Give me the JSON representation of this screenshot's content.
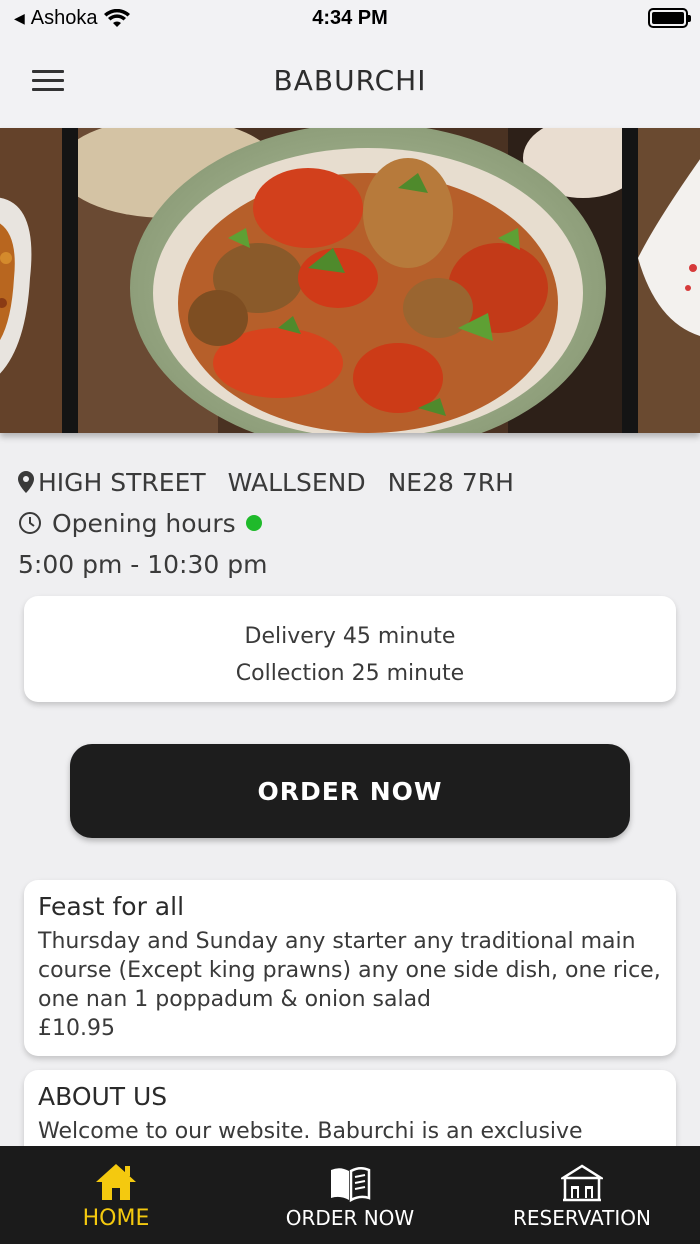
{
  "status_bar": {
    "carrier": "Ashoka",
    "time": "4:34 PM"
  },
  "nav": {
    "title": "BABURCHI"
  },
  "restaurant": {
    "address_parts": [
      "HIGH STREET",
      "WALLSEND",
      "NE28 7RH"
    ],
    "opening_label": "Opening hours",
    "hours": "5:00 pm - 10:30 pm",
    "open_status_color": "#1fba2b"
  },
  "delivery": {
    "delivery_text": "Delivery 45 minute",
    "collection_text": "Collection 25 minute"
  },
  "order_button": {
    "label": "ORDER NOW"
  },
  "cards": {
    "feast": {
      "title": "Feast for all",
      "body": "Thursday and Sunday any starter any traditional main course (Except king prawns) any one side dish, one rice, one nan 1 poppadum & onion salad",
      "price": "£10.95"
    },
    "about": {
      "title": "ABOUT US",
      "body": "Welcome to our website. Baburchi is an exclusive"
    }
  },
  "tabs": [
    {
      "label": "HOME",
      "icon": "house-icon",
      "active": true
    },
    {
      "label": "ORDER NOW",
      "icon": "open-book-icon",
      "active": false
    },
    {
      "label": "RESERVATION",
      "icon": "restaurant-building-icon",
      "active": false
    }
  ],
  "colors": {
    "accent": "#f4c90f",
    "tab_bar": "#1b1b1b",
    "button": "#1d1d1d",
    "background": "#efeff1"
  }
}
